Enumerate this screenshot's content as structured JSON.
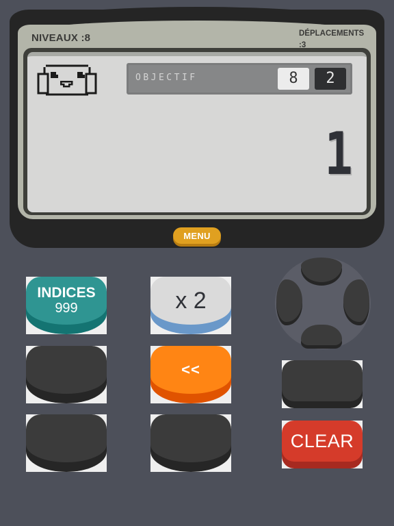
{
  "header": {
    "level_label": "NIVEAUX :8",
    "moves_label": "DÉPLACEMENTS",
    "moves_value": ":3"
  },
  "screen": {
    "mascot_icon": "smiling-face-pixel-icon",
    "objective_label": "OBJECTIF",
    "objective_target": "8",
    "objective_moves": "2",
    "display_value": "1"
  },
  "menu": {
    "label": "MENU"
  },
  "keys": {
    "hints_title": "INDICES",
    "hints_count": "999",
    "multiply": "x 2",
    "backspace": "<<",
    "clear": "CLEAR"
  },
  "colors": {
    "background": "#4d505a",
    "bezel": "#252525",
    "screen": "#d7d7d6",
    "menu": "#e0a020",
    "hints": "#2f9592",
    "multiply": "#dadada",
    "backspace": "#ff8514",
    "clear": "#d53b2a",
    "blank_key": "#3b3b3b"
  }
}
